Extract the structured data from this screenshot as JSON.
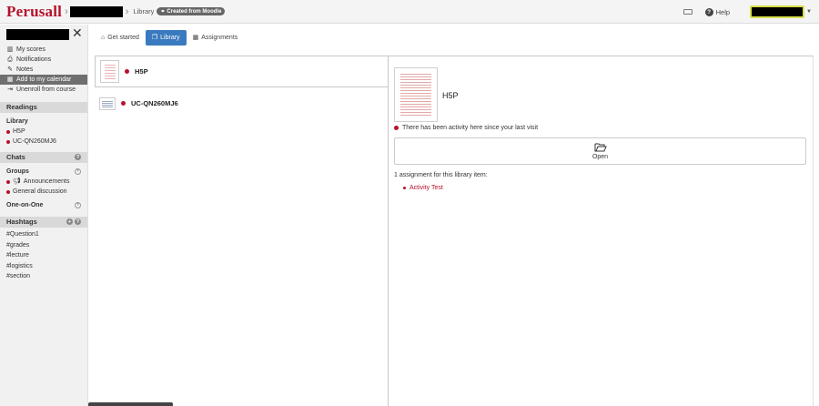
{
  "header": {
    "logo": "Perusall",
    "breadcrumb_library": "Library",
    "badge": "Created from Moodle",
    "help_label": "Help"
  },
  "sidebar": {
    "menu": [
      {
        "label": "My scores",
        "icon": "chart-icon"
      },
      {
        "label": "Notifications",
        "icon": "printer-icon"
      },
      {
        "label": "Notes",
        "icon": "pencil-icon"
      },
      {
        "label": "Add to my calendar",
        "icon": "calendar-icon"
      },
      {
        "label": "Unenroll from course",
        "icon": "exit-icon"
      }
    ],
    "readings_header": "Readings",
    "library_label": "Library",
    "readings": [
      "H5P",
      "UC-QN260MJ6"
    ],
    "chats_header": "Chats",
    "groups_label": "Groups",
    "groups": [
      "Announcements",
      "General discussion"
    ],
    "one_on_one_label": "One-on-One",
    "hashtags_header": "Hashtags",
    "hashtags": [
      "#Question1",
      "#grades",
      "#lecture",
      "#logistics",
      "#section"
    ]
  },
  "tabs": [
    {
      "label": "Get started"
    },
    {
      "label": "Library"
    },
    {
      "label": "Assignments"
    }
  ],
  "library_items": [
    {
      "title": "H5P"
    },
    {
      "title": "UC-QN260MJ6"
    }
  ],
  "detail": {
    "title": "H5P",
    "activity_text": "There has been activity here since your last visit",
    "open_label": "Open",
    "assignment_count_text": "1 assignment for this library item:",
    "assignments": [
      "Activity Test"
    ]
  },
  "colors": {
    "brand": "#b5122b",
    "active_tab": "#3a7bbf"
  }
}
